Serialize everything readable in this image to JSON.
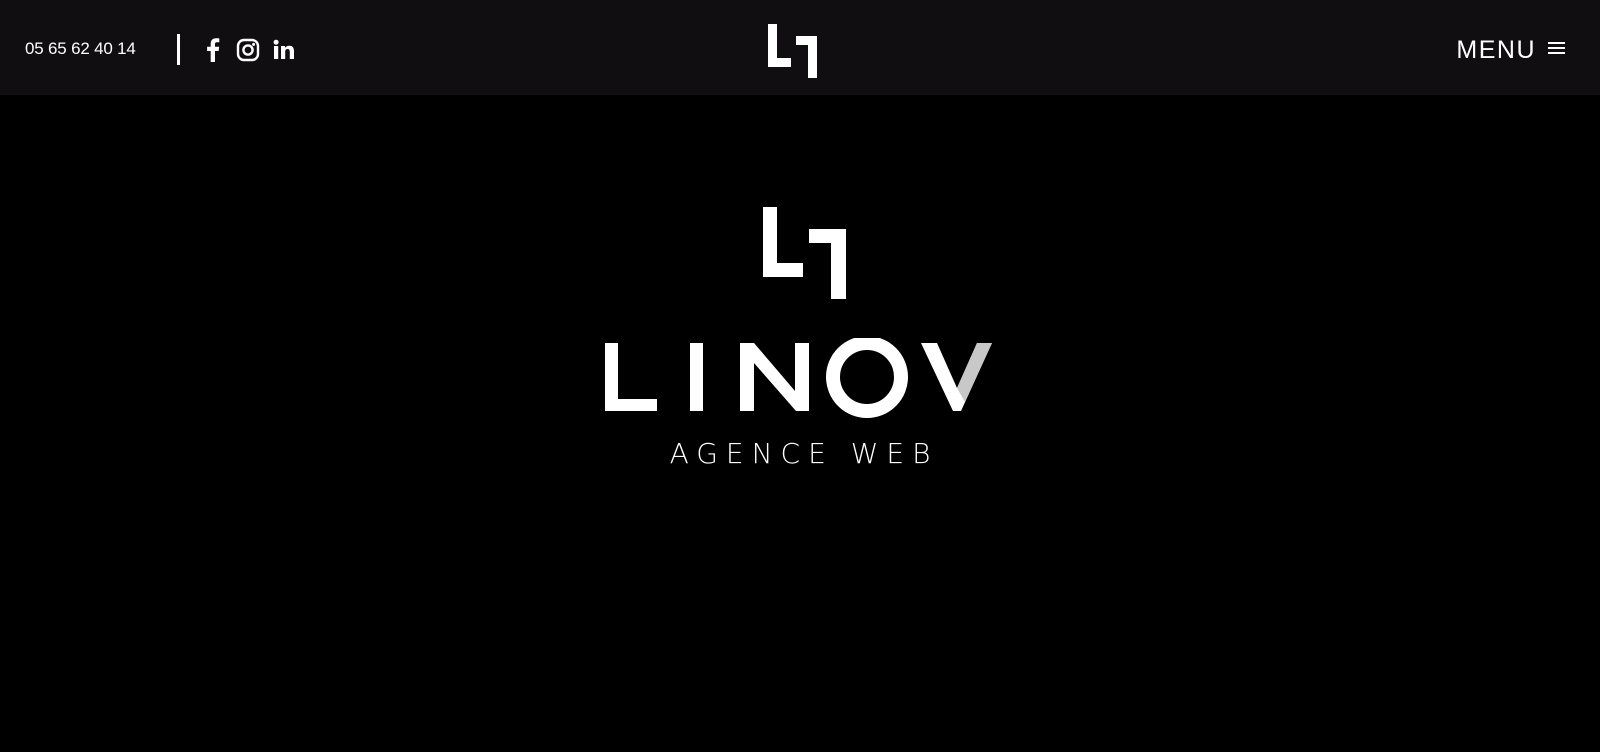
{
  "header": {
    "phone": "05 65 62 40 14",
    "social": [
      {
        "name": "facebook-icon"
      },
      {
        "name": "instagram-icon"
      },
      {
        "name": "linkedin-icon"
      }
    ],
    "logo_icon": "linov-mark-icon",
    "menu_label": "MENU",
    "menu_icon": "hamburger-icon"
  },
  "hero": {
    "logo_icon": "linov-mark-icon",
    "brand_name": "LINOV",
    "tagline": "AGENCE WEB"
  },
  "colors": {
    "header_bg": "#100e11",
    "page_bg": "#000000",
    "text": "#ffffff"
  }
}
